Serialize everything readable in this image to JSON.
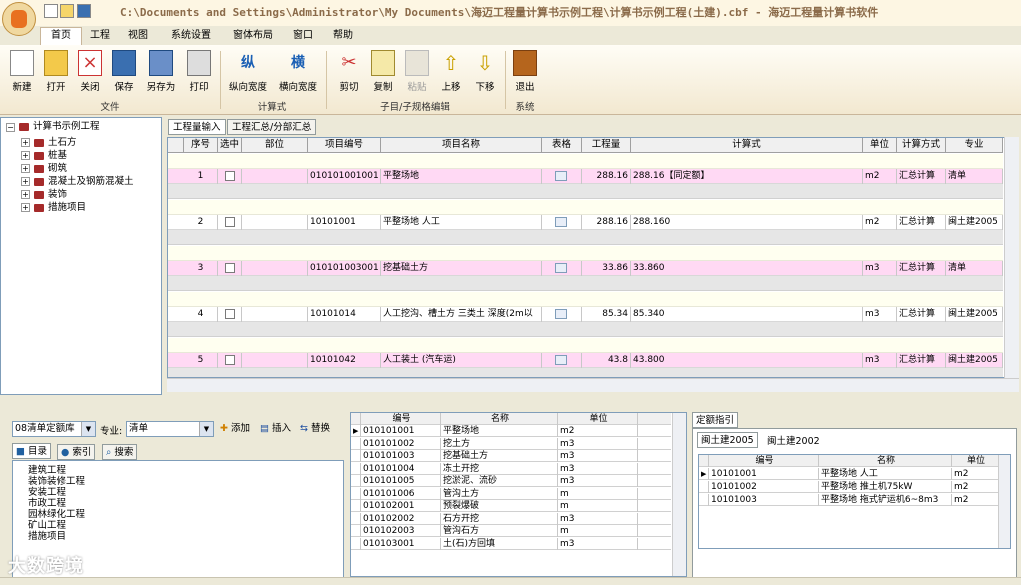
{
  "window": {
    "title": "C:\\Documents and Settings\\Administrator\\My Documents\\海迈工程量计算书示例工程\\计算书示例工程(土建).cbf - 海迈工程量计算书软件"
  },
  "menu": [
    "首页",
    "工程",
    "视图",
    "系统设置",
    "窗体布局",
    "窗口",
    "帮助"
  ],
  "ribbon": {
    "buttons": [
      {
        "label": "新建",
        "icon": "new-file-icon"
      },
      {
        "label": "打开",
        "icon": "open-folder-icon"
      },
      {
        "label": "关闭",
        "icon": "close-file-icon"
      },
      {
        "label": "保存",
        "icon": "save-icon"
      },
      {
        "label": "另存为",
        "icon": "save-as-icon"
      },
      {
        "label": "打印",
        "icon": "print-icon"
      },
      {
        "label": "纵向宽度",
        "icon": "vertical-width-icon"
      },
      {
        "label": "横向宽度",
        "icon": "horizontal-width-icon"
      },
      {
        "label": "剪切",
        "icon": "cut-icon"
      },
      {
        "label": "复制",
        "icon": "copy-icon"
      },
      {
        "label": "粘贴",
        "icon": "paste-icon"
      },
      {
        "label": "上移",
        "icon": "move-up-icon"
      },
      {
        "label": "下移",
        "icon": "move-down-icon"
      },
      {
        "label": "退出",
        "icon": "exit-icon"
      }
    ],
    "groups": [
      "文件",
      "计算式",
      "子目/子规格编辑",
      "系统"
    ],
    "icon_glyphs": {
      "vertical": "纵",
      "horizontal": "横"
    }
  },
  "tree": {
    "root": "计算书示例工程",
    "children": [
      "土石方",
      "桩基",
      "砌筑",
      "混凝土及钢筋混凝土",
      "装饰",
      "措施项目"
    ]
  },
  "grid_tabs": [
    "工程量输入",
    "工程汇总/分部汇总"
  ],
  "grid": {
    "columns": [
      "序号",
      "选中",
      "部位",
      "项目编号",
      "项目名称",
      "表格",
      "工程量",
      "计算式",
      "单位",
      "计算方式",
      "专业"
    ],
    "rows": [
      {
        "no": "1",
        "code": "010101001001",
        "name": "平整场地",
        "qty": "288.16",
        "formula": "288.16【同定额】",
        "unit": "m2",
        "method": "汇总计算",
        "spec": "清单"
      },
      {
        "no": "2",
        "code": "10101001",
        "name": "平整场地 人工",
        "qty": "288.16",
        "formula": "288.160",
        "unit": "m2",
        "method": "汇总计算",
        "spec": "闽土建2005"
      },
      {
        "no": "3",
        "code": "010101003001",
        "name": "挖基础土方",
        "qty": "33.86",
        "formula": "33.860",
        "unit": "m3",
        "method": "汇总计算",
        "spec": "清单"
      },
      {
        "no": "4",
        "code": "10101014",
        "name": "人工挖沟、槽土方  三类土 深度(2m以",
        "qty": "85.34",
        "formula": "85.340",
        "unit": "m3",
        "method": "汇总计算",
        "spec": "闽土建2005"
      },
      {
        "no": "5",
        "code": "10101042",
        "name": "人工装土 (汽车运)",
        "qty": "43.8",
        "formula": "43.800",
        "unit": "m3",
        "method": "汇总计算",
        "spec": "闽土建2005"
      }
    ]
  },
  "library": {
    "quota_lib": "08清单定额库",
    "spec_label": "专业:",
    "spec_value": "清单",
    "add": "添加",
    "insert": "插入",
    "replace": "替换",
    "tabs": [
      "目录",
      "索引",
      "搜索"
    ],
    "categories": [
      "建筑工程",
      "装饰装修工程",
      "安装工程",
      "市政工程",
      "园林绿化工程",
      "矿山工程",
      "措施项目"
    ]
  },
  "mid_table": {
    "columns": [
      "编号",
      "名称",
      "单位"
    ],
    "rows": [
      [
        "010101001",
        "平整场地",
        "m2"
      ],
      [
        "010101002",
        "挖土方",
        "m3"
      ],
      [
        "010101003",
        "挖基础土方",
        "m3"
      ],
      [
        "010101004",
        "冻土开挖",
        "m3"
      ],
      [
        "010101005",
        "挖淤泥、流砂",
        "m3"
      ],
      [
        "010101006",
        "管沟土方",
        "m"
      ],
      [
        "010102001",
        "预裂爆破",
        "m"
      ],
      [
        "010102002",
        "石方开挖",
        "m3"
      ],
      [
        "010102003",
        "管沟石方",
        "m"
      ],
      [
        "010103001",
        "土(石)方回填",
        "m3"
      ]
    ]
  },
  "quota_guide": {
    "title": "定额指引",
    "tabs": [
      "闽土建2005",
      "闽土建2002"
    ],
    "columns": [
      "编号",
      "名称",
      "单位"
    ],
    "rows": [
      [
        "10101001",
        "平整场地 人工",
        "m2"
      ],
      [
        "10101002",
        "平整场地 推土机75kW",
        "m2"
      ],
      [
        "10101003",
        "平整场地 拖式铲运机6~8m3",
        "m2"
      ]
    ]
  },
  "watermark": "大数跨境"
}
